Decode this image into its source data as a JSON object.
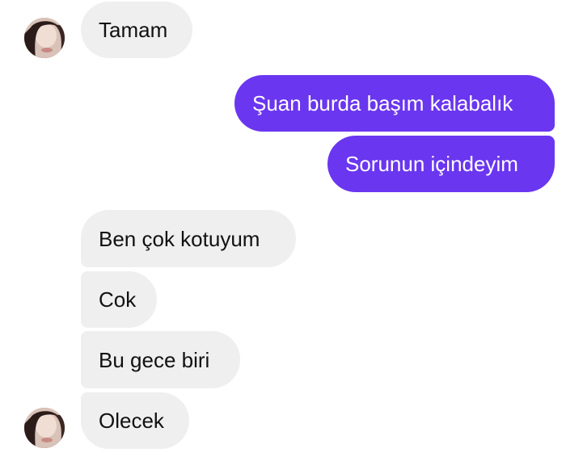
{
  "colors": {
    "incoming_bubble": "#efefef",
    "outgoing_bubble": "#6a36f0",
    "incoming_text": "#111111",
    "outgoing_text": "#ffffff"
  },
  "avatar_icon": "profile-photo",
  "messages": [
    {
      "sender": "other",
      "text": "Tamam"
    },
    {
      "sender": "me",
      "text": "Şuan burda başım kalabalık"
    },
    {
      "sender": "me",
      "text": "Sorunun içindeyim"
    },
    {
      "sender": "other",
      "text": "Ben çok kotuyum"
    },
    {
      "sender": "other",
      "text": "Cok"
    },
    {
      "sender": "other",
      "text": "Bu gece biri"
    },
    {
      "sender": "other",
      "text": "Olecek"
    }
  ]
}
